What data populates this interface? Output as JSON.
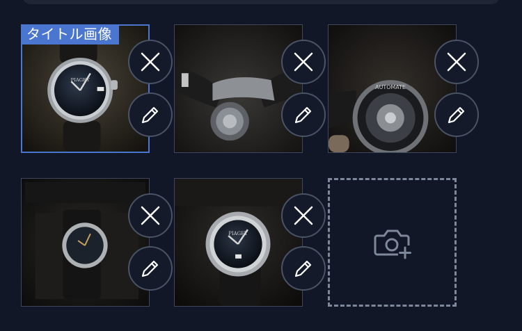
{
  "title_badge": {
    "label": "タイトル画像"
  },
  "photos": [
    {
      "name": "photo-1",
      "subject": "watch-front-dial",
      "is_title": true
    },
    {
      "name": "photo-2",
      "subject": "watch-side-caseback",
      "is_title": false
    },
    {
      "name": "photo-3",
      "subject": "watch-caseback-automatic",
      "is_title": false
    },
    {
      "name": "photo-4",
      "subject": "watch-in-box",
      "is_title": false
    },
    {
      "name": "photo-5",
      "subject": "watch-in-box-closeup",
      "is_title": false
    }
  ],
  "icons": {
    "delete": "close-icon",
    "edit": "pencil-icon",
    "add": "camera-add-icon"
  },
  "colors": {
    "background": "#111726",
    "accent": "#4a76cf",
    "button_border": "#4a5366",
    "dashed_border": "#7f879b"
  }
}
